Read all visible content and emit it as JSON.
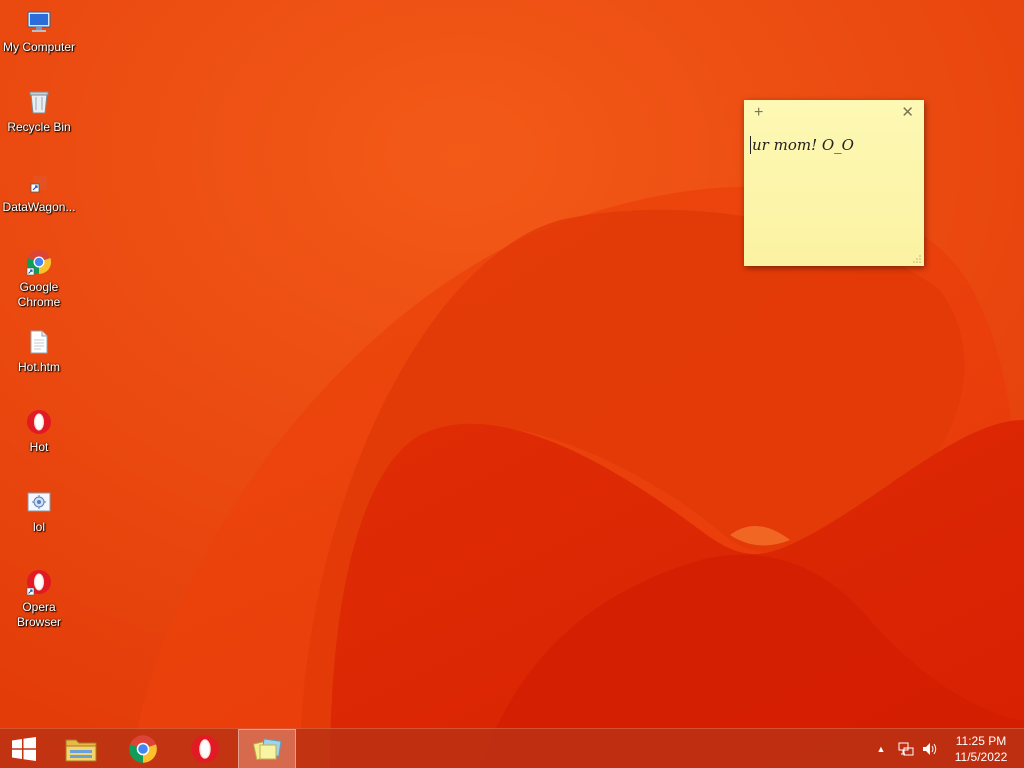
{
  "desktop": {
    "icons": [
      {
        "label": "My Computer",
        "icon": "computer-icon"
      },
      {
        "label": "Recycle Bin",
        "icon": "recycle-bin-icon"
      },
      {
        "label": "DataWagon...",
        "icon": "shortcut-icon"
      },
      {
        "label": "Google Chrome",
        "icon": "chrome-icon"
      },
      {
        "label": "Hot.htm",
        "icon": "html-file-icon"
      },
      {
        "label": "Hot",
        "icon": "opera-icon"
      },
      {
        "label": "lol",
        "icon": "image-file-icon"
      },
      {
        "label": "Opera Browser",
        "icon": "opera-icon"
      }
    ]
  },
  "sticky_note": {
    "add_glyph": "+",
    "close_glyph": "✕",
    "text": "ur mom! O_O"
  },
  "taskbar": {
    "pinned": [
      {
        "name": "start",
        "icon": "windows-logo-icon"
      },
      {
        "name": "file-explorer",
        "icon": "folder-icon"
      },
      {
        "name": "chrome",
        "icon": "chrome-icon"
      },
      {
        "name": "opera",
        "icon": "opera-icon"
      },
      {
        "name": "sticky-notes",
        "icon": "sticky-notes-icon",
        "active": true
      }
    ],
    "tray": {
      "show_hidden_glyph": "▲",
      "time": "11:25 PM",
      "date": "11/5/2022"
    }
  },
  "colors": {
    "wallpaper": "#e8420c",
    "sticky": "#fdf6ac",
    "taskbar": "#b83214"
  }
}
